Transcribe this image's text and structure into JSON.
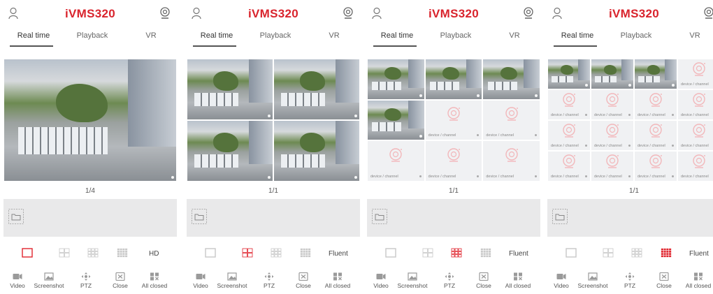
{
  "app": {
    "logo": "iVMS320"
  },
  "tabs": [
    "Real time",
    "Playback",
    "VR"
  ],
  "empty_label": "device / channel",
  "toolbar": [
    {
      "label": "Video",
      "icon": "video-camera-icon"
    },
    {
      "label": "Screenshot",
      "icon": "screenshot-icon"
    },
    {
      "label": "PTZ",
      "icon": "ptz-move-icon"
    },
    {
      "label": "Close",
      "icon": "close-window-icon"
    },
    {
      "label": "All closed",
      "icon": "all-closed-icon"
    }
  ],
  "split_options": [
    "1x1-layout-icon",
    "2x2-layout-icon",
    "3x3-layout-icon",
    "4x4-layout-icon"
  ],
  "colors": {
    "brand": "#d9242d",
    "active": "#e0242d",
    "inactive": "#c8c8c8"
  },
  "panels": [
    {
      "grid": 1,
      "page": "1/4",
      "stream": "HD",
      "active_split": 0,
      "live_cells": 1
    },
    {
      "grid": 2,
      "page": "1/1",
      "stream": "Fluent",
      "active_split": 1,
      "live_cells": 4
    },
    {
      "grid": 3,
      "page": "1/1",
      "stream": "Fluent",
      "active_split": 2,
      "live_cells": 4
    },
    {
      "grid": 4,
      "page": "1/1",
      "stream": "Fluent",
      "active_split": 3,
      "live_cells": 3
    }
  ]
}
